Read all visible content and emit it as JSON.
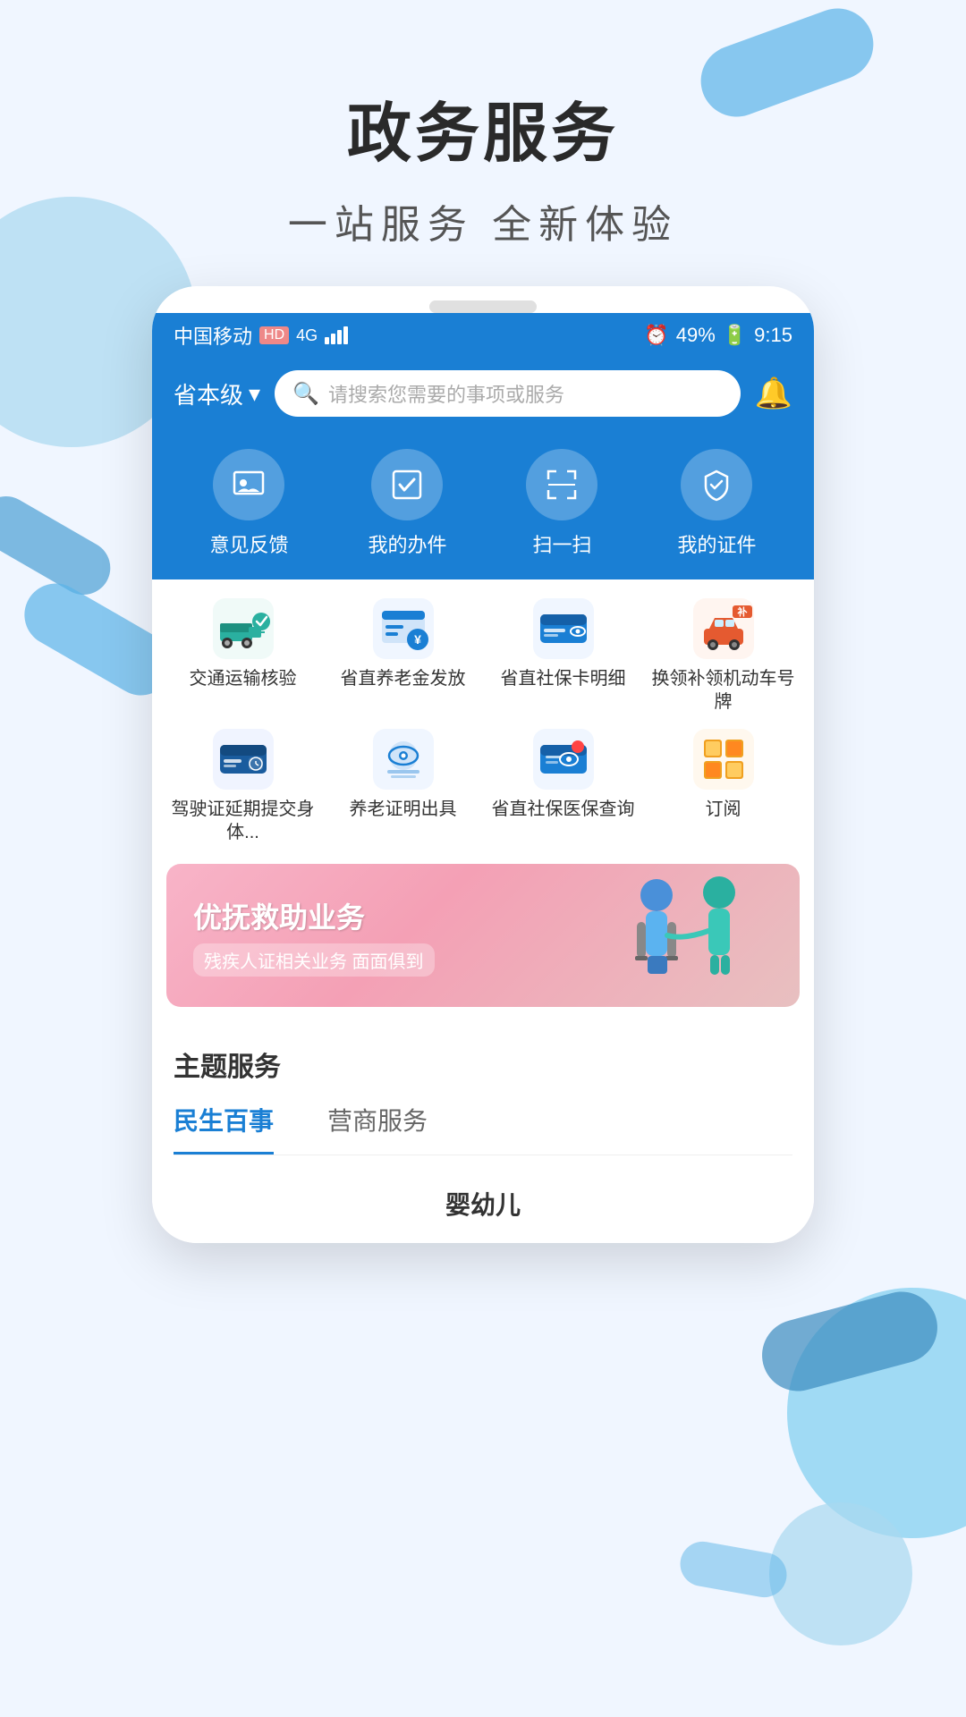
{
  "page": {
    "title": "政务服务",
    "subtitle": "一站服务   全新体验"
  },
  "status_bar": {
    "carrier": "中国移动",
    "network": "4G",
    "battery": "49%",
    "time": "9:15"
  },
  "search": {
    "location": "省本级",
    "placeholder": "请搜索您需要的事项或服务"
  },
  "quick_actions": [
    {
      "id": "feedback",
      "label": "意见反馈",
      "icon": "id-card"
    },
    {
      "id": "mywork",
      "label": "我的办件",
      "icon": "checkbox"
    },
    {
      "id": "scan",
      "label": "扫一扫",
      "icon": "scan"
    },
    {
      "id": "mycert",
      "label": "我的证件",
      "icon": "cube"
    }
  ],
  "services": [
    {
      "id": "transport",
      "label": "交通运输核\n验",
      "color": "#2ab0a0"
    },
    {
      "id": "pension_payment",
      "label": "省直养老金\n发放",
      "color": "#1a7fd4"
    },
    {
      "id": "social_card",
      "label": "省直社保卡\n明细",
      "color": "#1a7fd4"
    },
    {
      "id": "plate",
      "label": "换领补领机\n动车号牌",
      "color": "#e55a30"
    },
    {
      "id": "license",
      "label": "驾驶证延期\n提交身体...",
      "color": "#1a5c9e"
    },
    {
      "id": "pension_cert",
      "label": "养老证明出\n具",
      "color": "#1a7fd4"
    },
    {
      "id": "medical",
      "label": "省直社保医\n保查询",
      "color": "#1a7fd4"
    },
    {
      "id": "subscribe",
      "label": "订阅",
      "color": "#f0a020"
    }
  ],
  "banner": {
    "title": "优抚救助业务",
    "subtitle": "残疾人证相关业务  面面俱到"
  },
  "theme_section": {
    "title": "主题服务",
    "tabs": [
      {
        "id": "livelihood",
        "label": "民生百事",
        "active": true
      },
      {
        "id": "business",
        "label": "营商服务",
        "active": false
      }
    ],
    "active_section": "婴幼儿"
  }
}
